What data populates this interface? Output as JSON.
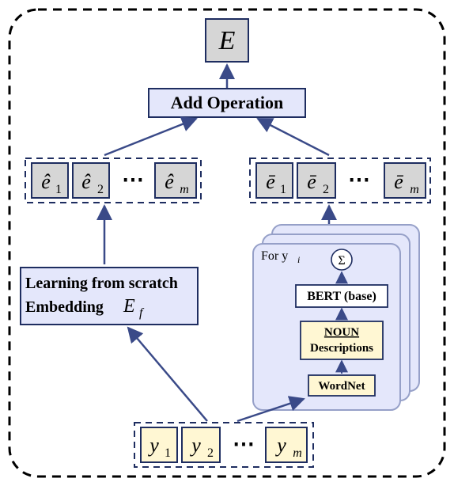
{
  "top": {
    "output_label": "E",
    "add_op": "Add Operation"
  },
  "left_embeds": {
    "e1": "ê",
    "e1_sub": "1",
    "e2": "ê",
    "e2_sub": "2",
    "dots": "⋯",
    "em": "ê",
    "em_sub": "m"
  },
  "right_embeds": {
    "e1": "ē",
    "e1_sub": "1",
    "e2": "ē",
    "e2_sub": "2",
    "dots": "⋯",
    "em": "ē",
    "em_sub": "m"
  },
  "left_module": {
    "line1": "Learning from scratch",
    "line2_a": "Embedding",
    "line2_b": "E",
    "line2_b_sub": "f"
  },
  "right_module": {
    "for_label": "For  y",
    "for_sub": "i",
    "sigma": "Σ",
    "bert": "BERT (base)",
    "noun1": "NOUN",
    "noun2": "Descriptions",
    "wordnet": "WordNet"
  },
  "inputs": {
    "y1": "y",
    "y1_sub": "1",
    "y2": "y",
    "y2_sub": "2",
    "dots": "⋯",
    "ym": "y",
    "ym_sub": "m"
  }
}
